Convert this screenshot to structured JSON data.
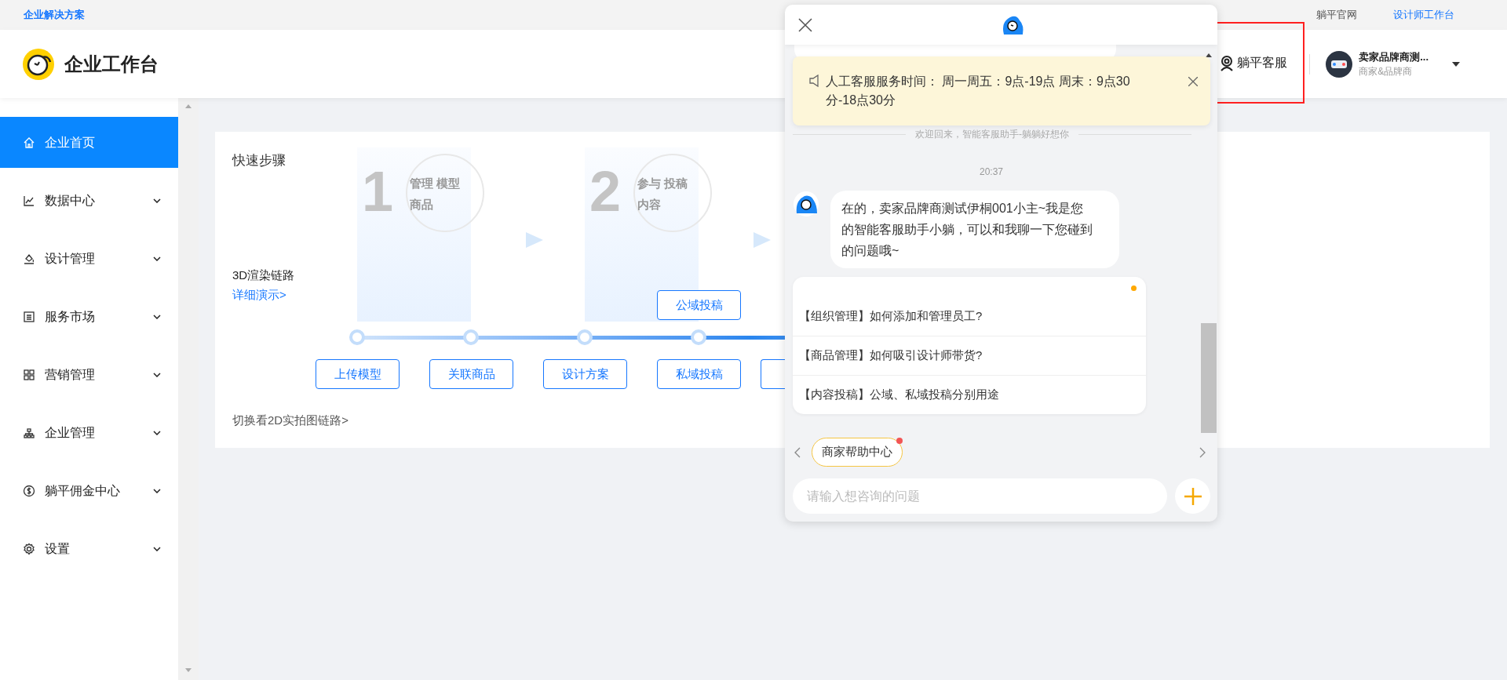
{
  "top_bar": {
    "left_link": "企业解决方案",
    "right_links": [
      {
        "label": "躺平官网",
        "selected": false
      },
      {
        "label": "设计师工作台",
        "selected": true
      }
    ]
  },
  "header": {
    "title": "企业工作台",
    "service_label": "躺平客服",
    "user": {
      "name": "卖家品牌商测...",
      "role": "商家&品牌商"
    }
  },
  "sidebar": {
    "items": [
      {
        "label": "企业首页",
        "selected": true,
        "expandable": false
      },
      {
        "label": "数据中心",
        "selected": false,
        "expandable": true
      },
      {
        "label": "设计管理",
        "selected": false,
        "expandable": true
      },
      {
        "label": "服务市场",
        "selected": false,
        "expandable": true
      },
      {
        "label": "营销管理",
        "selected": false,
        "expandable": true
      },
      {
        "label": "企业管理",
        "selected": false,
        "expandable": true
      },
      {
        "label": "躺平佣金中心",
        "selected": false,
        "expandable": true
      },
      {
        "label": "设置",
        "selected": false,
        "expandable": true
      }
    ]
  },
  "quick_steps": {
    "title": "快速步骤",
    "chain_label": "3D渲染链路",
    "demo_link": "详细演示>",
    "switch_link": "切换看2D实拍图链路>",
    "stages": [
      {
        "number": "1",
        "line1": "管理",
        "line2": "模型商品"
      },
      {
        "number": "2",
        "line1": "参与",
        "line2": "投稿内容"
      }
    ],
    "steps": [
      {
        "label": "上传模型"
      },
      {
        "label": "关联商品"
      },
      {
        "label": "设计方案"
      },
      {
        "label": "私域投稿",
        "above": "公域投稿"
      }
    ]
  },
  "chat": {
    "notice": "人工客服服务时间： 周一周五：9点-19点 周末：9点30分-18点30分",
    "welcome": "欢迎回来，智能客服助手-躺躺好想你",
    "time": "20:37",
    "message": "在的，卖家品牌商测试伊桐001小主~我是您的智能客服助手小躺，可以和我聊一下您碰到的问题哦~",
    "questions": [
      "【组织管理】如何添加和管理员工?",
      "【商品管理】如何吸引设计师带货?",
      "【内容投稿】公域、私域投稿分别用途"
    ],
    "chips": [
      {
        "label": "商家帮助中心",
        "unread": true
      }
    ],
    "input": {
      "placeholder": "请输入想咨询的问题"
    }
  }
}
